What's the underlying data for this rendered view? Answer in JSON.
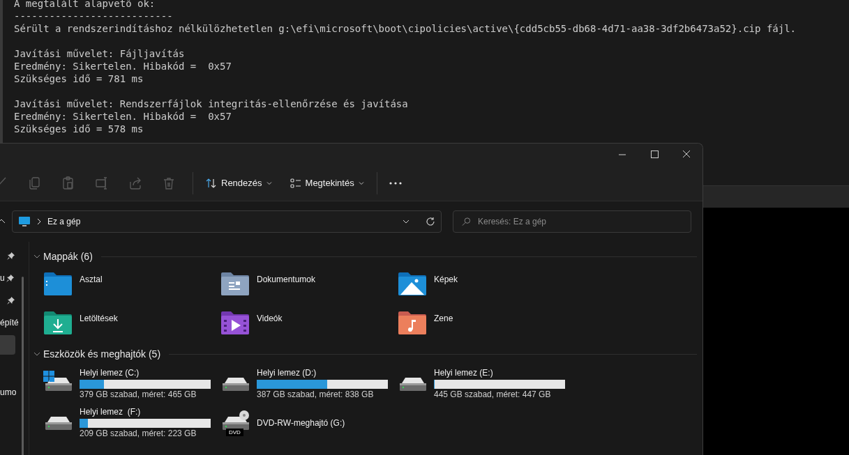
{
  "terminal": {
    "blocks": [
      [
        "A megtalált alapvető ok:",
        "---------------------------",
        "Sérült a rendszerindításhoz nélkülözhetetlen g:\\efi\\microsoft\\boot\\cipolicies\\active\\{cdd5cb55-db68-4d71-aa38-3df2b6473a52}.cip fájl."
      ],
      [
        "Javítási művelet: Fájljavítás",
        "Eredmény: Sikertelen. Hibakód =  0x57",
        "Szükséges idő = 781 ms"
      ],
      [
        "Javítási művelet: Rendszerfájlok integritás-ellenőrzése és javítása",
        "Eredmény: Sikertelen. Hibakód =  0x57",
        "Szükséges idő = 578 ms"
      ]
    ]
  },
  "explorer": {
    "toolbar": {
      "actions": [
        {
          "kind": "cut",
          "disabled": true
        },
        {
          "kind": "copy",
          "disabled": true
        },
        {
          "kind": "paste",
          "disabled": true
        },
        {
          "kind": "rename",
          "disabled": true
        },
        {
          "kind": "share",
          "disabled": true
        },
        {
          "kind": "delete",
          "disabled": true
        }
      ],
      "sort_button": "Rendezés",
      "view_button": "Megtekintés"
    },
    "address": {
      "location": "Ez a gép"
    },
    "search": {
      "placeholder": "Keresés: Ez a gép"
    },
    "sidebar": {
      "items": [
        {
          "pinned": true,
          "selected": false
        },
        {
          "label": "u",
          "pinned": true,
          "selected": false
        },
        {
          "pinned": true,
          "selected": false
        },
        {
          "label": "építé",
          "pinned": false,
          "selected": false
        },
        {
          "pinned": false,
          "selected": true
        },
        {
          "label": "umo",
          "pinned": false,
          "selected": false
        }
      ]
    },
    "folders_section": {
      "title": "Mappák (6)",
      "expanded": true,
      "folders": [
        {
          "kind": "desktop",
          "label": "Asztal"
        },
        {
          "kind": "documents",
          "label": "Dokumentumok"
        },
        {
          "kind": "pictures",
          "label": "Képek"
        },
        {
          "kind": "downloads",
          "label": "Letöltések"
        },
        {
          "kind": "videos",
          "label": "Videók"
        },
        {
          "kind": "music",
          "label": "Zene"
        }
      ]
    },
    "drives_section": {
      "title": "Eszközök és meghajtók (5)",
      "expanded": true,
      "drives": [
        {
          "kind": "system_disk",
          "label": "Helyi lemez (C:)",
          "level": 0.185,
          "space": "379 GB szabad, méret: 465 GB"
        },
        {
          "kind": "disk",
          "label": "Helyi lemez (D:)",
          "level": 0.538,
          "space": "387 GB szabad, méret: 838 GB"
        },
        {
          "kind": "disk",
          "label": "Helyi lemez (E:)",
          "level": 0.004,
          "space": "445 GB szabad, méret: 447 GB"
        },
        {
          "kind": "disk",
          "label": "Helyi lemez  (F:)",
          "level": 0.063,
          "space": "209 GB szabad, méret: 223 GB"
        },
        {
          "kind": "dvd",
          "label": "DVD-RW-meghajtó (G:)",
          "badge": "DVD"
        }
      ]
    }
  }
}
